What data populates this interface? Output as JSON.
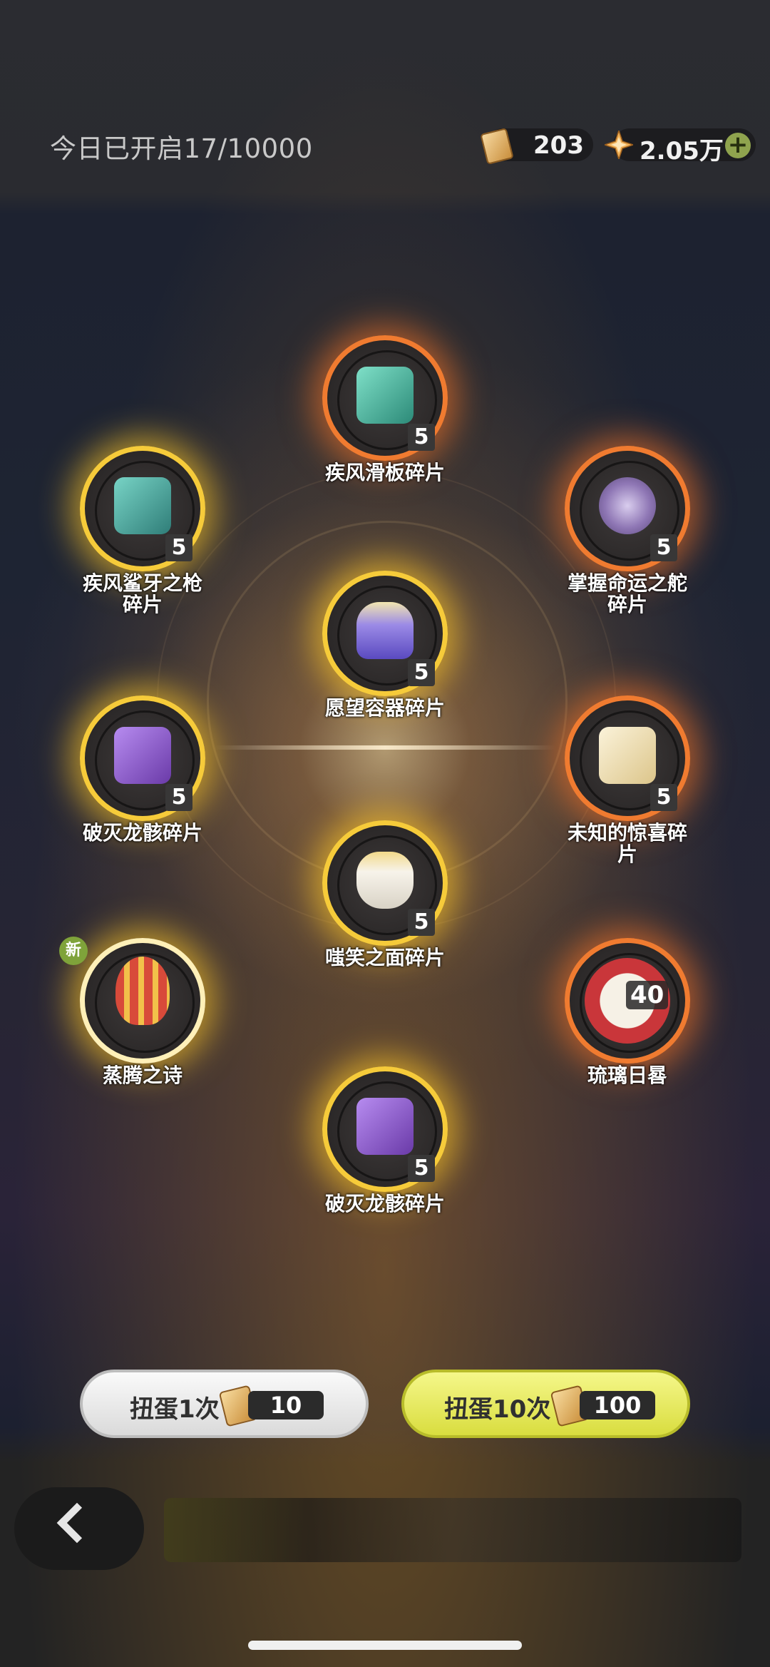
{
  "header": {
    "opened_today": "今日已开启17/10000",
    "ticket_count": "203",
    "star_count": "2.05万",
    "add_icon": "plus-icon"
  },
  "items": [
    {
      "id": "top",
      "name": "疾风滑板碎片",
      "count": "5",
      "glow": "orange",
      "art_color": "#3fb39a"
    },
    {
      "id": "left1",
      "name": "疾风鲨牙之枪碎片",
      "count": "5",
      "glow": "gold",
      "art_color": "#4fa39a"
    },
    {
      "id": "right1",
      "name": "掌握命运之舵碎片",
      "count": "5",
      "glow": "orange",
      "art_color": "#8f77b5"
    },
    {
      "id": "center1",
      "name": "愿望容器碎片",
      "count": "5",
      "glow": "gold",
      "art_color": "#7d6ad6"
    },
    {
      "id": "left2",
      "name": "破灭龙骸碎片",
      "count": "5",
      "glow": "gold",
      "art_color": "#8752c9"
    },
    {
      "id": "right2",
      "name": "未知的惊喜碎片",
      "count": "5",
      "glow": "orange",
      "art_color": "#e8d59a"
    },
    {
      "id": "center2",
      "name": "嗤笑之面碎片",
      "count": "5",
      "glow": "gold",
      "art_color": "#ece6d8"
    },
    {
      "id": "left3",
      "name": "蒸腾之诗",
      "badge": "新",
      "glow": "gold",
      "art_color": "#d84a3a"
    },
    {
      "id": "right3",
      "name": "琉璃日晷",
      "count": "40",
      "glow": "orange",
      "art_color": "#c9363a"
    },
    {
      "id": "bottom",
      "name": "破灭龙骸碎片",
      "count": "5",
      "glow": "gold",
      "art_color": "#8752c9"
    }
  ],
  "buttons": {
    "single": {
      "label": "扭蛋1次",
      "cost": "10"
    },
    "ten": {
      "label": "扭蛋10次",
      "cost": "100"
    }
  },
  "nav": {
    "back_icon": "chevron-left-icon"
  }
}
